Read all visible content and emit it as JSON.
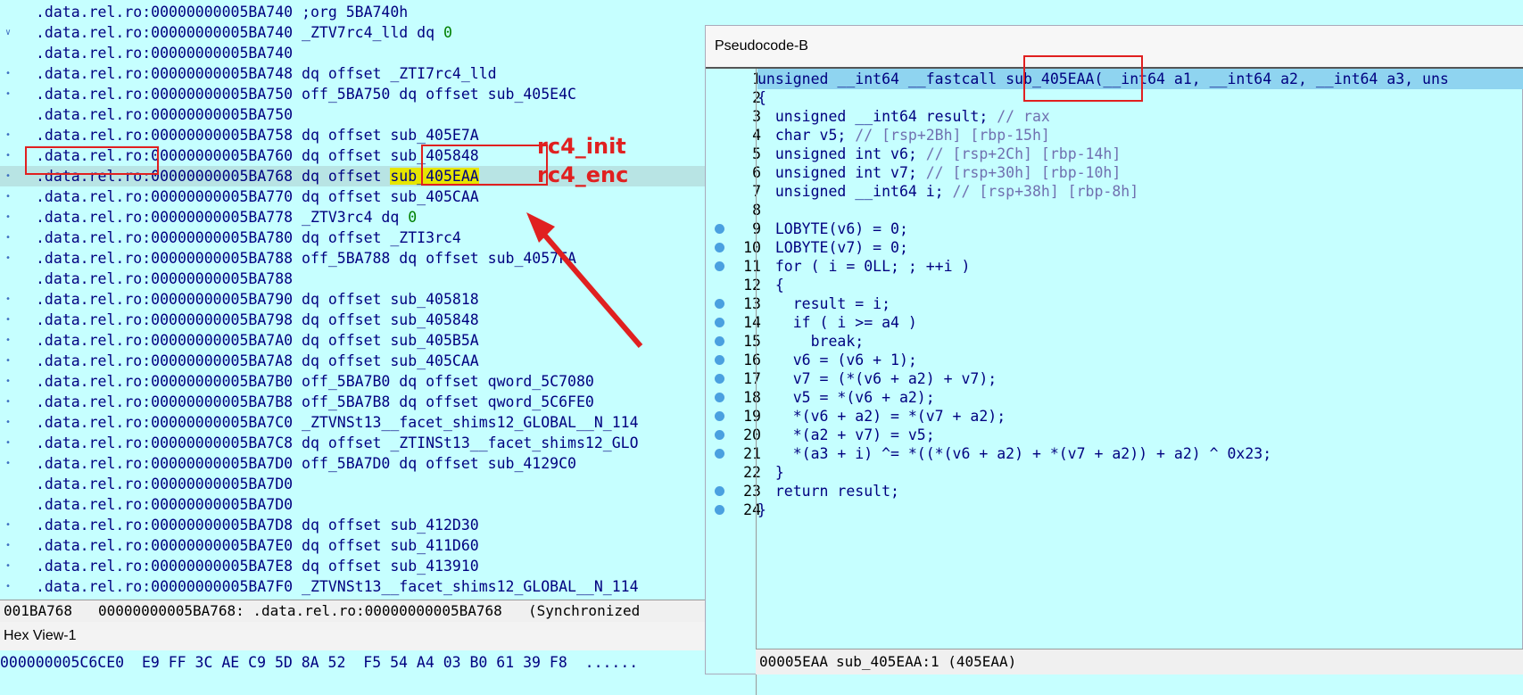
{
  "disasm": {
    "lines": [
      {
        "mark": "",
        "addr": ".data.rel.ro:00000000005BA740",
        "rest": " ;org 5BA740h",
        "hl": false
      },
      {
        "mark": "∨",
        "addr": ".data.rel.ro:00000000005BA740",
        "rest": " _ZTV7rc4_lld dq ",
        "num": "0",
        "hl": false
      },
      {
        "mark": "",
        "addr": ".data.rel.ro:00000000005BA740",
        "rest": "",
        "hl": false
      },
      {
        "mark": "•",
        "addr": ".data.rel.ro:00000000005BA748",
        "rest": " dq offset _ZTI7rc4_lld",
        "hl": false
      },
      {
        "mark": "•",
        "addr": ".data.rel.ro:00000000005BA750",
        "rest": " off_5BA750 dq offset sub_405E4C",
        "hl": false
      },
      {
        "mark": "",
        "addr": ".data.rel.ro:00000000005BA750",
        "rest": "",
        "hl": false
      },
      {
        "mark": "•",
        "addr": ".data.rel.ro:00000000005BA758",
        "rest": " dq offset sub_405E7A",
        "hl": false
      },
      {
        "mark": "•",
        "addr": ".data.rel.ro:00000000005BA760",
        "rest": " dq offset sub_405848",
        "hl": false
      },
      {
        "mark": "•",
        "addr": ".data.rel.ro:00000000005BA768",
        "rest": " dq offset ",
        "sel": "sub_405EAA",
        "hl": true
      },
      {
        "mark": "•",
        "addr": ".data.rel.ro:00000000005BA770",
        "rest": " dq offset sub_405CAA",
        "hl": false
      },
      {
        "mark": "•",
        "addr": ".data.rel.ro:00000000005BA778",
        "rest": " _ZTV3rc4 dq ",
        "num": "0",
        "hl": false
      },
      {
        "mark": "•",
        "addr": ".data.rel.ro:00000000005BA780",
        "rest": " dq offset _ZTI3rc4",
        "hl": false
      },
      {
        "mark": "•",
        "addr": ".data.rel.ro:00000000005BA788",
        "rest": " off_5BA788 dq offset sub_4057FA",
        "hl": false
      },
      {
        "mark": "",
        "addr": ".data.rel.ro:00000000005BA788",
        "rest": "",
        "hl": false
      },
      {
        "mark": "•",
        "addr": ".data.rel.ro:00000000005BA790",
        "rest": " dq offset sub_405818",
        "hl": false
      },
      {
        "mark": "•",
        "addr": ".data.rel.ro:00000000005BA798",
        "rest": " dq offset sub_405848",
        "hl": false
      },
      {
        "mark": "•",
        "addr": ".data.rel.ro:00000000005BA7A0",
        "rest": " dq offset sub_405B5A",
        "hl": false
      },
      {
        "mark": "•",
        "addr": ".data.rel.ro:00000000005BA7A8",
        "rest": " dq offset sub_405CAA",
        "hl": false
      },
      {
        "mark": "•",
        "addr": ".data.rel.ro:00000000005BA7B0",
        "rest": " off_5BA7B0 dq offset qword_5C7080",
        "hl": false
      },
      {
        "mark": "•",
        "addr": ".data.rel.ro:00000000005BA7B8",
        "rest": " off_5BA7B8 dq offset qword_5C6FE0",
        "hl": false
      },
      {
        "mark": "•",
        "addr": ".data.rel.ro:00000000005BA7C0",
        "rest": " _ZTVNSt13__facet_shims12_GLOBAL__N_114",
        "hl": false
      },
      {
        "mark": "•",
        "addr": ".data.rel.ro:00000000005BA7C8",
        "rest": " dq offset _ZTINSt13__facet_shims12_GLO",
        "hl": false
      },
      {
        "mark": "•",
        "addr": ".data.rel.ro:00000000005BA7D0",
        "rest": " off_5BA7D0 dq offset sub_4129C0",
        "hl": false
      },
      {
        "mark": "",
        "addr": ".data.rel.ro:00000000005BA7D0",
        "rest": "",
        "hl": false
      },
      {
        "mark": "",
        "addr": ".data.rel.ro:00000000005BA7D0",
        "rest": "",
        "hl": false
      },
      {
        "mark": "•",
        "addr": ".data.rel.ro:00000000005BA7D8",
        "rest": " dq offset sub_412D30",
        "hl": false
      },
      {
        "mark": "•",
        "addr": ".data.rel.ro:00000000005BA7E0",
        "rest": " dq offset sub_411D60",
        "hl": false
      },
      {
        "mark": "•",
        "addr": ".data.rel.ro:00000000005BA7E8",
        "rest": " dq offset sub_413910",
        "hl": false
      },
      {
        "mark": "•",
        "addr": ".data.rel.ro:00000000005BA7F0",
        "rest": " _ZTVNSt13__facet_shims12_GLOBAL__N_114",
        "hl": false
      }
    ],
    "status": {
      "offset": "001BA768",
      "addr": "00000000005BA768: .data.rel.ro:00000000005BA768",
      "sync": "(Synchronized"
    }
  },
  "hexview": {
    "title": "Hex View-1",
    "row": "000000005C6CE0  E9 FF 3C AE C9 5D 8A 52  F5 54 A4 03 B0 61 39 F8  ......"
  },
  "pseudo": {
    "title": "Pseudocode-B",
    "lines": [
      {
        "n": "1",
        "bp": false,
        "code": "unsigned __int64 __fastcall sub_405EAA(__int64 a1, __int64 a2, __int64 a3, uns"
      },
      {
        "n": "2",
        "bp": false,
        "code": "{"
      },
      {
        "n": "3",
        "bp": false,
        "code": "  unsigned __int64 result; ",
        "cm": "// rax"
      },
      {
        "n": "4",
        "bp": false,
        "code": "  char v5; ",
        "cm": "// [rsp+2Bh] [rbp-15h]"
      },
      {
        "n": "5",
        "bp": false,
        "code": "  unsigned int v6; ",
        "cm": "// [rsp+2Ch] [rbp-14h]"
      },
      {
        "n": "6",
        "bp": false,
        "code": "  unsigned int v7; ",
        "cm": "// [rsp+30h] [rbp-10h]"
      },
      {
        "n": "7",
        "bp": false,
        "code": "  unsigned __int64 i; ",
        "cm": "// [rsp+38h] [rbp-8h]"
      },
      {
        "n": "8",
        "bp": false,
        "code": ""
      },
      {
        "n": "9",
        "bp": true,
        "code": "  LOBYTE(v6) = 0;"
      },
      {
        "n": "10",
        "bp": true,
        "code": "  LOBYTE(v7) = 0;"
      },
      {
        "n": "11",
        "bp": true,
        "code": "  for ( i = 0LL; ; ++i )"
      },
      {
        "n": "12",
        "bp": false,
        "code": "  {"
      },
      {
        "n": "13",
        "bp": true,
        "code": "    result = i;"
      },
      {
        "n": "14",
        "bp": true,
        "code": "    if ( i >= a4 )"
      },
      {
        "n": "15",
        "bp": true,
        "code": "      break;"
      },
      {
        "n": "16",
        "bp": true,
        "code": "    v6 = (v6 + 1);"
      },
      {
        "n": "17",
        "bp": true,
        "code": "    v7 = (*(v6 + a2) + v7);"
      },
      {
        "n": "18",
        "bp": true,
        "code": "    v5 = *(v6 + a2);"
      },
      {
        "n": "19",
        "bp": true,
        "code": "    *(v6 + a2) = *(v7 + a2);"
      },
      {
        "n": "20",
        "bp": true,
        "code": "    *(a2 + v7) = v5;"
      },
      {
        "n": "21",
        "bp": true,
        "code": "    *(a3 + i) ^= *((*(v6 + a2) + *(v7 + a2)) + a2) ^ 0x23;"
      },
      {
        "n": "22",
        "bp": false,
        "code": "  }"
      },
      {
        "n": "23",
        "bp": true,
        "code": "  return result;"
      },
      {
        "n": "24",
        "bp": true,
        "code": "}"
      }
    ],
    "status": {
      "addr": "00005EAA",
      "loc": "sub_405EAA:1 (405EAA)"
    }
  },
  "annotations": {
    "init": "rc4_init",
    "enc": "rc4_enc"
  },
  "colors": {
    "bg": "#c6ffff",
    "accent": "#e02020",
    "highlight": "#e6e600"
  }
}
